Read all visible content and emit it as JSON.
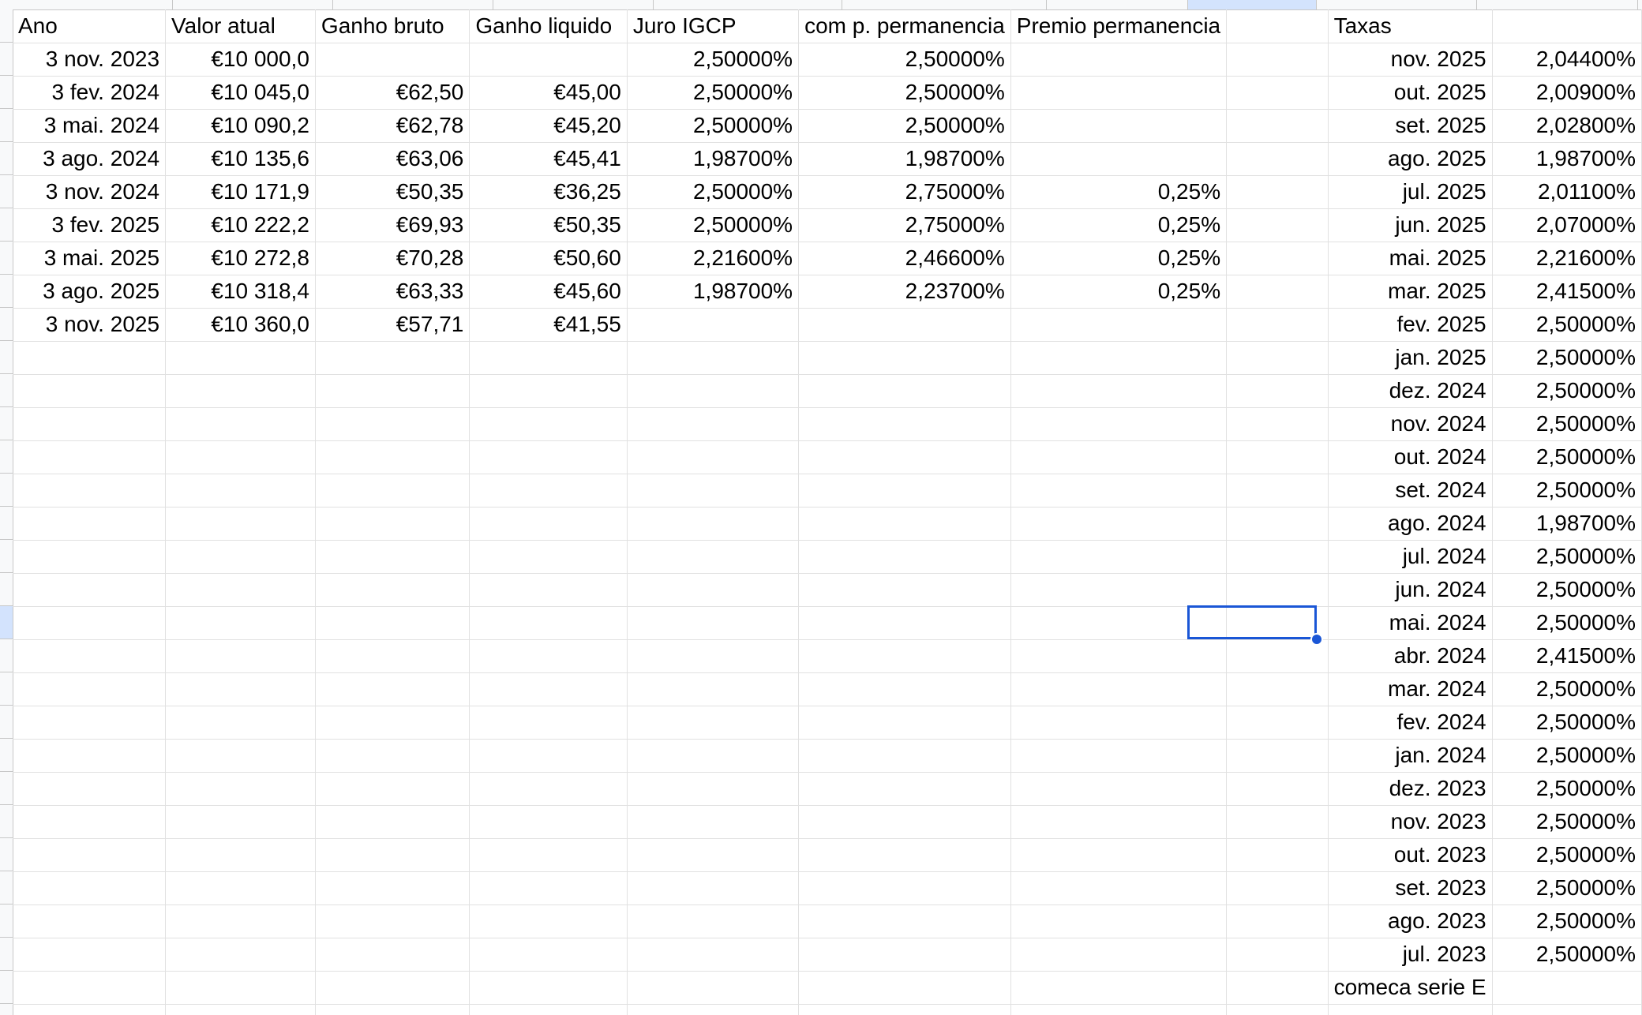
{
  "sheet": {
    "rows": [
      [
        "Ano",
        "Valor atual",
        "Ganho bruto",
        "Ganho liquido",
        "Juro IGCP",
        "com p. permanencia",
        "Premio permanencia",
        "",
        "Taxas",
        ""
      ],
      [
        "3 nov. 2023",
        "€10 000,0",
        "",
        "",
        "2,50000%",
        "2,50000%",
        "",
        "",
        "nov. 2025",
        "2,04400%"
      ],
      [
        "3 fev. 2024",
        "€10 045,0",
        "€62,50",
        "€45,00",
        "2,50000%",
        "2,50000%",
        "",
        "",
        "out. 2025",
        "2,00900%"
      ],
      [
        "3 mai. 2024",
        "€10 090,2",
        "€62,78",
        "€45,20",
        "2,50000%",
        "2,50000%",
        "",
        "",
        "set. 2025",
        "2,02800%"
      ],
      [
        "3 ago. 2024",
        "€10 135,6",
        "€63,06",
        "€45,41",
        "1,98700%",
        "1,98700%",
        "",
        "",
        "ago. 2025",
        "1,98700%"
      ],
      [
        "3 nov. 2024",
        "€10 171,9",
        "€50,35",
        "€36,25",
        "2,50000%",
        "2,75000%",
        "0,25%",
        "",
        "jul. 2025",
        "2,01100%"
      ],
      [
        "3 fev. 2025",
        "€10 222,2",
        "€69,93",
        "€50,35",
        "2,50000%",
        "2,75000%",
        "0,25%",
        "",
        "jun. 2025",
        "2,07000%"
      ],
      [
        "3 mai. 2025",
        "€10 272,8",
        "€70,28",
        "€50,60",
        "2,21600%",
        "2,46600%",
        "0,25%",
        "",
        "mai. 2025",
        "2,21600%"
      ],
      [
        "3 ago. 2025",
        "€10 318,4",
        "€63,33",
        "€45,60",
        "1,98700%",
        "2,23700%",
        "0,25%",
        "",
        "mar. 2025",
        "2,41500%"
      ],
      [
        "3 nov. 2025",
        "€10 360,0",
        "€57,71",
        "€41,55",
        "",
        "",
        "",
        "",
        "fev. 2025",
        "2,50000%"
      ],
      [
        "",
        "",
        "",
        "",
        "",
        "",
        "",
        "",
        "jan. 2025",
        "2,50000%"
      ],
      [
        "",
        "",
        "",
        "",
        "",
        "",
        "",
        "",
        "dez. 2024",
        "2,50000%"
      ],
      [
        "",
        "",
        "",
        "",
        "",
        "",
        "",
        "",
        "nov. 2024",
        "2,50000%"
      ],
      [
        "",
        "",
        "",
        "",
        "",
        "",
        "",
        "",
        "out. 2024",
        "2,50000%"
      ],
      [
        "",
        "",
        "",
        "",
        "",
        "",
        "",
        "",
        "set. 2024",
        "2,50000%"
      ],
      [
        "",
        "",
        "",
        "",
        "",
        "",
        "",
        "",
        "ago. 2024",
        "1,98700%"
      ],
      [
        "",
        "",
        "",
        "",
        "",
        "",
        "",
        "",
        "jul. 2024",
        "2,50000%"
      ],
      [
        "",
        "",
        "",
        "",
        "",
        "",
        "",
        "",
        "jun. 2024",
        "2,50000%"
      ],
      [
        "",
        "",
        "",
        "",
        "",
        "",
        "",
        "",
        "mai. 2024",
        "2,50000%"
      ],
      [
        "",
        "",
        "",
        "",
        "",
        "",
        "",
        "",
        "abr. 2024",
        "2,41500%"
      ],
      [
        "",
        "",
        "",
        "",
        "",
        "",
        "",
        "",
        "mar. 2024",
        "2,50000%"
      ],
      [
        "",
        "",
        "",
        "",
        "",
        "",
        "",
        "",
        "fev. 2024",
        "2,50000%"
      ],
      [
        "",
        "",
        "",
        "",
        "",
        "",
        "",
        "",
        "jan. 2024",
        "2,50000%"
      ],
      [
        "",
        "",
        "",
        "",
        "",
        "",
        "",
        "",
        "dez. 2023",
        "2,50000%"
      ],
      [
        "",
        "",
        "",
        "",
        "",
        "",
        "",
        "",
        "nov. 2023",
        "2,50000%"
      ],
      [
        "",
        "",
        "",
        "",
        "",
        "",
        "",
        "",
        "out. 2023",
        "2,50000%"
      ],
      [
        "",
        "",
        "",
        "",
        "",
        "",
        "",
        "",
        "set. 2023",
        "2,50000%"
      ],
      [
        "",
        "",
        "",
        "",
        "",
        "",
        "",
        "",
        "ago. 2023",
        "2,50000%"
      ],
      [
        "",
        "",
        "",
        "",
        "",
        "",
        "",
        "",
        "jul. 2023",
        "2,50000%"
      ],
      [
        "",
        "",
        "",
        "",
        "",
        "",
        "",
        "",
        "comeca serie E",
        ""
      ],
      [
        "",
        "",
        "",
        "",
        "",
        "",
        "",
        "",
        "",
        ""
      ]
    ],
    "selected_cell": {
      "row": 18,
      "col": 7
    },
    "colors": {
      "selection": "#1a56d6",
      "active_header": "#d3e3fd",
      "gridline": "#e1e1e1",
      "header_bg": "#f8f9fa"
    }
  }
}
